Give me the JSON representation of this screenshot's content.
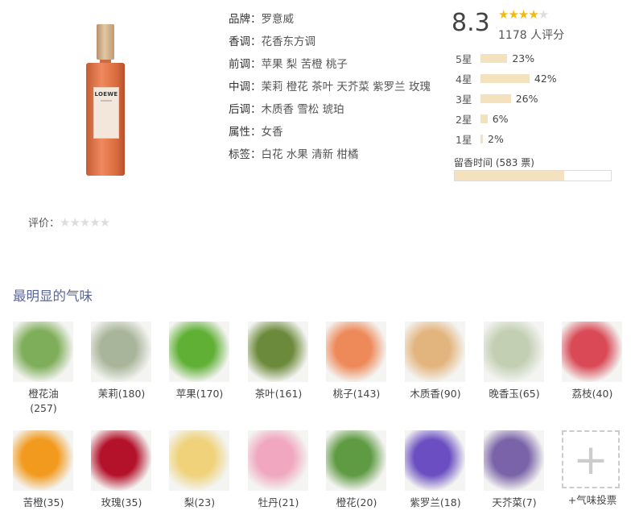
{
  "product": {
    "bottle_brand": "LOEWE"
  },
  "info": [
    {
      "key": "品牌：",
      "value": "罗意威"
    },
    {
      "key": "香调：",
      "value": "花香东方调"
    },
    {
      "key": "前调：",
      "value": "苹果 梨 苦橙 桃子"
    },
    {
      "key": "中调：",
      "value": "茉莉 橙花 茶叶 天芥菜 紫罗兰 玫瑰"
    },
    {
      "key": "后调：",
      "value": "木质香 雪松 琥珀"
    },
    {
      "key": "属性：",
      "value": "女香"
    },
    {
      "key": "标签：",
      "value": "白花 水果 清新 柑橘"
    }
  ],
  "rating": {
    "score": "8.3",
    "stars_filled": 4,
    "stars_total": 5,
    "count": "1178 人评分",
    "distribution": [
      {
        "label": "5星",
        "pct": "23%",
        "value": 23
      },
      {
        "label": "4星",
        "pct": "42%",
        "value": 42
      },
      {
        "label": "3星",
        "pct": "26%",
        "value": 26
      },
      {
        "label": "2星",
        "pct": "6%",
        "value": 6
      },
      {
        "label": "1星",
        "pct": "2%",
        "value": 2
      }
    ],
    "longevity_label": "留香时间 (583 票)",
    "longevity_fraction": 0.7
  },
  "review": {
    "label": "评价：",
    "stars": "★★★★★"
  },
  "notes_title": "最明显的气味",
  "notes": [
    {
      "name": "橙花油(257)",
      "color": "#7fae5a"
    },
    {
      "name": "茉莉(180)",
      "color": "#a9b59a"
    },
    {
      "name": "苹果(170)",
      "color": "#5fb035"
    },
    {
      "name": "茶叶(161)",
      "color": "#6c8a3b"
    },
    {
      "name": "桃子(143)",
      "color": "#ee8a5a"
    },
    {
      "name": "木质香(90)",
      "color": "#e3b57e"
    },
    {
      "name": "晚香玉(65)",
      "color": "#c2cfb3"
    },
    {
      "name": "荔枝(40)",
      "color": "#d94a56"
    },
    {
      "name": "苦橙(35)",
      "color": "#f29a1e"
    },
    {
      "name": "玫瑰(35)",
      "color": "#b3122a"
    },
    {
      "name": "梨(23)",
      "color": "#efd27a"
    },
    {
      "name": "牡丹(21)",
      "color": "#f0a7bf"
    },
    {
      "name": "橙花(20)",
      "color": "#5f9b43"
    },
    {
      "name": "紫罗兰(18)",
      "color": "#6b4fc2"
    },
    {
      "name": "天芥菜(7)",
      "color": "#7a63a8"
    }
  ],
  "vote_label": "+气味投票"
}
